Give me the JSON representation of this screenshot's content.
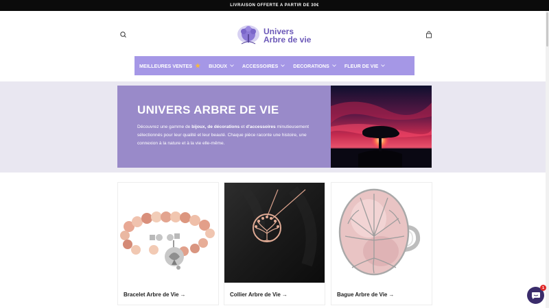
{
  "announcement": {
    "text": "LIVRAISON OFFERTE A PARTIR DE 30€"
  },
  "header": {
    "logo_line1": "Univers",
    "logo_line2": "Arbre de vie",
    "search_icon": "search-icon",
    "cart_icon": "bag-icon"
  },
  "nav": {
    "items": [
      {
        "label": "MEILLEURES VENTES",
        "icon": "star-icon"
      },
      {
        "label": "BIJOUX",
        "icon": "chevron-down-icon"
      },
      {
        "label": "ACCESSOIRES",
        "icon": "chevron-down-icon"
      },
      {
        "label": "DECORATIONS",
        "icon": "chevron-down-icon"
      },
      {
        "label": "FLEUR DE VIE",
        "icon": "chevron-down-icon"
      }
    ],
    "background": "#a597e6"
  },
  "hero": {
    "title": "UNIVERS ARBRE DE VIE",
    "desc_part1": "Découvrez une gamme de ",
    "desc_bold1": "bijoux, de décorations",
    "desc_part2": " et ",
    "desc_bold2": "d'accessoires",
    "desc_part3": " minutieusement sélectionnés pour leur qualité et leur beauté. Chaque pièce raconte une histoire, une connexion à la nature et à la vie elle-même.",
    "card_color": "#998ac9",
    "band_color": "#e9e7f1"
  },
  "products": [
    {
      "title": "Bracelet Arbre de Vie",
      "arrow": "→"
    },
    {
      "title": "Collier Arbre de Vie",
      "arrow": "→"
    },
    {
      "title": "Bague Arbre de Vie",
      "arrow": "→"
    }
  ],
  "chat": {
    "badge": "1",
    "icon": "chat-icon"
  }
}
